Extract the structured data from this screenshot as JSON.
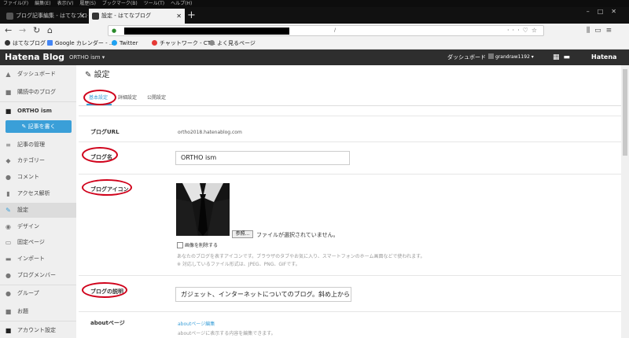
{
  "menubar": [
    "ファイル(F)",
    "編集(E)",
    "表示(V)",
    "履歴(S)",
    "ブックマーク(B)",
    "ツール(T)",
    "ヘルプ(H)"
  ],
  "tabs": [
    {
      "title": "ブログ記事編集 - はてなブログ"
    },
    {
      "title": "設定 - はてなブログ"
    }
  ],
  "bookmarks": [
    {
      "label": "はてなブログ",
      "color": "#333333"
    },
    {
      "label": "Google カレンダー - ...",
      "color": "#4285f4"
    },
    {
      "label": "Twitter",
      "color": "#1da1f2"
    },
    {
      "label": "チャットワーク - CT...",
      "color": "#e53935"
    },
    {
      "label": "よく見るページ",
      "color": "#888888"
    }
  ],
  "header": {
    "logo": "Hatena Blog",
    "blog_name": "ORTHO ism ▾",
    "dashboard": "ダッシュボード",
    "user": "grandraw1192 ▾",
    "brand": "Hatena"
  },
  "sidebar": {
    "items": [
      {
        "label": "ダッシュボード",
        "icon": "▲"
      },
      {
        "label": "購読中のブログ",
        "icon": "■"
      },
      {
        "label": "ORTHO ism",
        "icon": "■"
      },
      {
        "label": "記事の管理",
        "icon": "≡"
      },
      {
        "label": "カテゴリー",
        "icon": "◆"
      },
      {
        "label": "コメント",
        "icon": "●"
      },
      {
        "label": "アクセス解析",
        "icon": "▮"
      },
      {
        "label": "設定",
        "icon": "✎"
      },
      {
        "label": "デザイン",
        "icon": "◉"
      },
      {
        "label": "固定ページ",
        "icon": "▭"
      },
      {
        "label": "インポート",
        "icon": "▬"
      },
      {
        "label": "ブログメンバー",
        "icon": "●"
      },
      {
        "label": "グループ",
        "icon": "●"
      },
      {
        "label": "お題",
        "icon": "■"
      },
      {
        "label": "アカウント設定",
        "icon": "■"
      }
    ],
    "write_button": "✎ 記事を書く"
  },
  "page": {
    "title": "設定",
    "tabs": [
      "基本設定",
      "詳細設定",
      "公開設定"
    ]
  },
  "settings": {
    "blog_url_label": "ブログURL",
    "blog_url_value": "ortho2018.hatenablog.com",
    "blog_name_label": "ブログ名",
    "blog_name_value": "ORTHO ism",
    "blog_icon_label": "ブログアイコン",
    "browse_button": "参照...",
    "no_file_text": "ファイルが選択されていません。",
    "delete_image_label": "画像を削除する",
    "icon_help_1": "あなたのブログを表すアイコンです。ブラウザのタブやお気に入り、スマートフォンのホーム画面などで使われます。",
    "icon_help_2": "※ 対応しているファイル形式は、JPEG、PNG、GIFです。",
    "description_label": "ブログの説明",
    "description_value": "ガジェット、インターネットについてのブログ。斜め上からレ!",
    "about_label": "aboutページ",
    "about_link": "aboutページ編集",
    "about_help": "aboutページに表示する内容を編集できます。"
  },
  "colors": {
    "accent": "#3a9fd8",
    "highlight_circle": "#d0021b",
    "header_bg": "#2e2e2e"
  }
}
